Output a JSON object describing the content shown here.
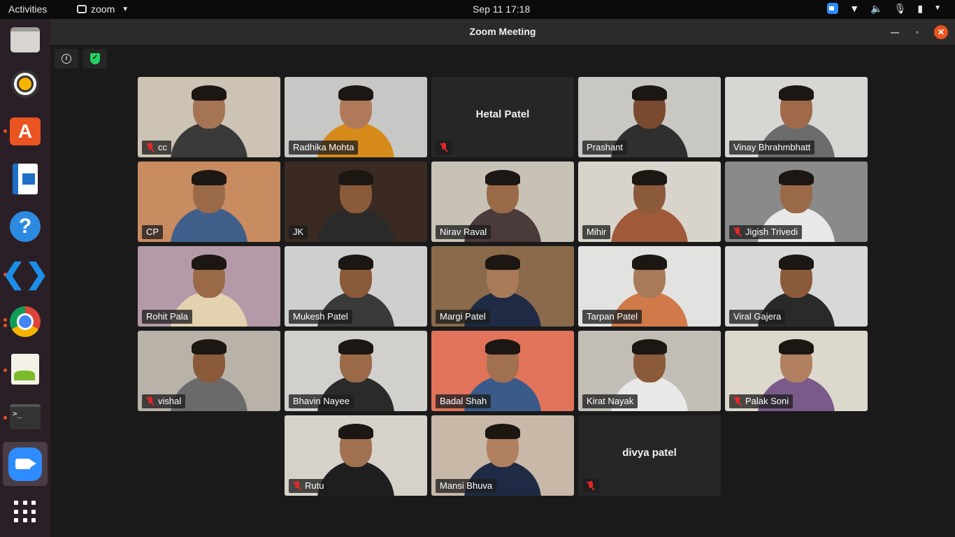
{
  "topbar": {
    "activities": "Activities",
    "app_name": "zoom",
    "clock": "Sep 11  17:18"
  },
  "window": {
    "title": "Zoom Meeting"
  },
  "dock": {
    "items": [
      "files-icon",
      "rhythmbox-icon",
      "software-store-icon",
      "writer-icon",
      "help-icon",
      "vscode-icon",
      "chrome-icon",
      "text-editor-icon",
      "terminal-icon",
      "zoom-icon",
      "show-apps-icon"
    ]
  },
  "participants": [
    {
      "name": "cc",
      "muted": true,
      "video": true,
      "bg": "#cdc3b4",
      "shirt": "#3a3a3a",
      "skin": "#a57455"
    },
    {
      "name": "Radhika Mohta",
      "muted": false,
      "video": true,
      "speaking": true,
      "bg": "#c7c8c6",
      "shirt": "#d58a1a",
      "skin": "#b07a5a"
    },
    {
      "name": "Hetal Patel",
      "muted": true,
      "video": false
    },
    {
      "name": "Prashant",
      "muted": false,
      "video": true,
      "bg": "#c9c7c2",
      "shirt": "#2f2f2f",
      "skin": "#7a4a30"
    },
    {
      "name": "Vinay Bhrahmbhatt",
      "muted": false,
      "video": true,
      "bg": "#d6d6d2",
      "shirt": "#6b6b6b",
      "skin": "#a06a4a"
    },
    {
      "name": "CP",
      "muted": false,
      "video": true,
      "bg": "#c98b60",
      "shirt": "#3f5f8a",
      "skin": "#9a6a48"
    },
    {
      "name": "JK",
      "muted": false,
      "video": true,
      "bg": "#3a2a22",
      "shirt": "#2a2a2a",
      "skin": "#8a5a3a"
    },
    {
      "name": "Nirav Raval",
      "muted": false,
      "video": true,
      "bg": "#c8c2b6",
      "shirt": "#4a3a3a",
      "skin": "#9a6a48"
    },
    {
      "name": "Mihir",
      "muted": false,
      "video": true,
      "bg": "#d8d4cc",
      "shirt": "#a05a3a",
      "skin": "#8a5a3a"
    },
    {
      "name": "Jigish Trivedi",
      "muted": true,
      "video": true,
      "bg": "#8a8a8a",
      "shirt": "#e8e8e8",
      "skin": "#9a6a48"
    },
    {
      "name": "Rohit Pala",
      "muted": false,
      "video": true,
      "bg": "#b49aa8",
      "shirt": "#e3d2b0",
      "skin": "#9a6a48"
    },
    {
      "name": "Mukesh Patel",
      "muted": false,
      "video": true,
      "bg": "#cfcfcf",
      "shirt": "#3a3a3a",
      "skin": "#8a5a3a"
    },
    {
      "name": "Margi Patel",
      "muted": false,
      "video": true,
      "bg": "#8a6a4a",
      "shirt": "#1f2a44",
      "skin": "#a87a5a"
    },
    {
      "name": "Tarpan Patel",
      "muted": false,
      "video": true,
      "bg": "#e2e2e0",
      "shirt": "#d07a4a",
      "skin": "#a87a5a"
    },
    {
      "name": "Viral Gajera",
      "muted": false,
      "video": true,
      "bg": "#d8d8d8",
      "shirt": "#2a2a2a",
      "skin": "#8a5a3a"
    },
    {
      "name": "vishal",
      "muted": true,
      "video": true,
      "bg": "#b8b2a8",
      "shirt": "#6a6a6a",
      "skin": "#8a5a3a"
    },
    {
      "name": "Bhavin Nayee",
      "muted": false,
      "video": true,
      "bg": "#d2d0cc",
      "shirt": "#2a2a2a",
      "skin": "#9a6a48"
    },
    {
      "name": "Badal Shah",
      "muted": false,
      "video": true,
      "bg": "#e0735a",
      "shirt": "#3a5a8a",
      "skin": "#a07050"
    },
    {
      "name": "Kirat Nayak",
      "muted": false,
      "video": true,
      "bg": "#c2beb6",
      "shirt": "#e8e8e8",
      "skin": "#8a5a3a"
    },
    {
      "name": "Palak Soni",
      "muted": true,
      "video": true,
      "bg": "#ddd8cc",
      "shirt": "#7a5a8a",
      "skin": "#b08060"
    },
    {
      "name": "Rutu",
      "muted": true,
      "video": true,
      "bg": "#d6d2ca",
      "shirt": "#1f1f1f",
      "skin": "#a07050"
    },
    {
      "name": "Mansi Bhuva",
      "muted": false,
      "video": true,
      "bg": "#c8b8a8",
      "shirt": "#1f2a44",
      "skin": "#b08060"
    },
    {
      "name": "divya patel",
      "muted": true,
      "video": false
    }
  ]
}
